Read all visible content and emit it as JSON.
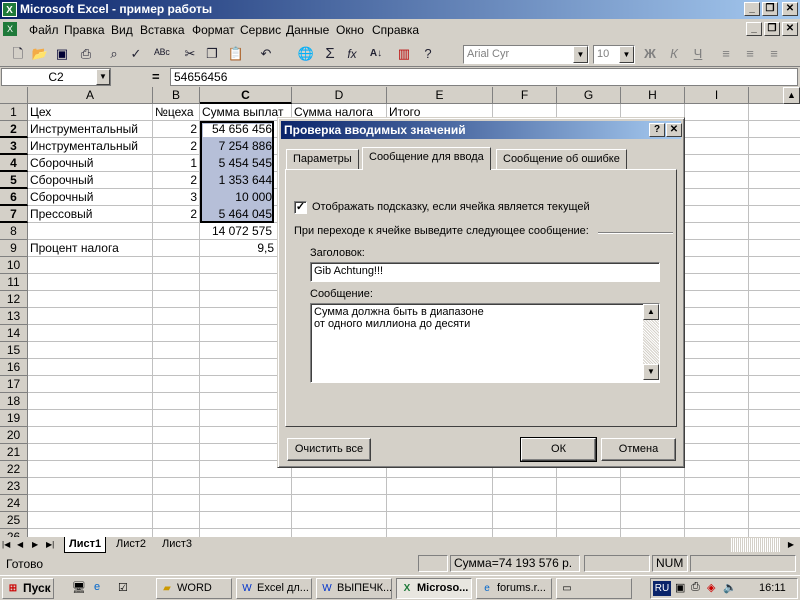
{
  "window": {
    "title": "Microsoft Excel - пример работы"
  },
  "menu": [
    "Файл",
    "Правка",
    "Вид",
    "Вставка",
    "Формат",
    "Сервис",
    "Данные",
    "Окно",
    "Справка"
  ],
  "toolbar": {
    "font_name": "Arial Cyr",
    "font_size": "10",
    "bold": "Ж",
    "italic": "К",
    "underline": "Ч"
  },
  "formula": {
    "cell_ref": "C2",
    "eq": "=",
    "value": "54656456"
  },
  "columns": [
    "A",
    "B",
    "C",
    "D",
    "E",
    "F",
    "G",
    "H",
    "I"
  ],
  "rows": [
    "1",
    "2",
    "3",
    "4",
    "5",
    "6",
    "7",
    "8",
    "9",
    "10",
    "11",
    "12",
    "13",
    "14",
    "15",
    "16",
    "17",
    "18",
    "19",
    "20",
    "21",
    "22",
    "23",
    "24",
    "25",
    "26"
  ],
  "cells": {
    "a1": "Цех",
    "b1": "№цеха",
    "c1": "Сумма выплат",
    "d1": "Сумма налога",
    "e1": "Итого",
    "a2": "Инструментальный",
    "b2": "2",
    "c2": "54 656 456",
    "a3": "Инструментальный",
    "b3": "2",
    "c3": "7 254 886",
    "a4": "Сборочный",
    "b4": "1",
    "c4": "5 454 545",
    "a5": "Сборочный",
    "b5": "2",
    "c5": "1 353 644",
    "a6": "Сборочный",
    "b6": "3",
    "c6": "10 000",
    "a7": "Прессовый",
    "b7": "2",
    "c7": "5 464 045",
    "c8": "14 072 575",
    "a9": "Процент налога",
    "c9": "9,5"
  },
  "sheets": [
    "Лист1",
    "Лист2",
    "Лист3"
  ],
  "status": {
    "ready": "Готово",
    "sum": "Сумма=74 193 576 р.",
    "num": "NUM"
  },
  "taskbar": {
    "start": "Пуск",
    "tasks": [
      "WORD",
      "Excel дл...",
      "ВЫПЕЧК...",
      "Microso...",
      "forums.r...",
      ""
    ],
    "lang": "RU",
    "clock": "16:11"
  },
  "dialog": {
    "title": "Проверка вводимых значений",
    "help": "?",
    "close": "✕",
    "tabs": [
      "Параметры",
      "Сообщение для ввода",
      "Сообщение об ошибке"
    ],
    "checkbox_label": "Отображать подсказку, если ячейка является текущей",
    "group_label": "При переходе к ячейке выведите следующее сообщение:",
    "heading_label": "Заголовок:",
    "heading_value": "Gib Achtung!!!",
    "message_label": "Сообщение:",
    "message_lines": [
      "Сумма должна быть в диапазоне",
      "от одного миллиона до десяти"
    ],
    "clear_btn": "Очистить все",
    "ok_btn": "ОК",
    "cancel_btn": "Отмена"
  },
  "colors": {
    "title_active": "#0a246a",
    "selection": "#b6bfd8",
    "face": "#d4d0c8"
  },
  "icons": [
    "excel-icon",
    "new-icon",
    "open-icon",
    "save-icon",
    "print-icon",
    "preview-icon",
    "spell-icon",
    "cut-icon",
    "copy-icon",
    "paste-icon",
    "undo-icon",
    "web-icon",
    "autosum-icon",
    "function-icon",
    "sort-icon",
    "chart-icon",
    "help-icon"
  ]
}
